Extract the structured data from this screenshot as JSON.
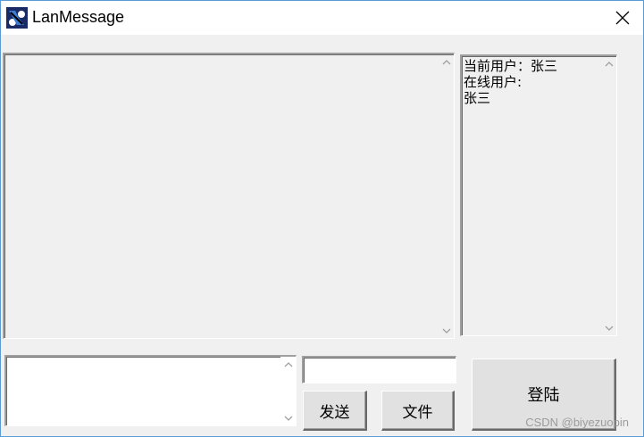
{
  "window": {
    "title": "LanMessage"
  },
  "user_panel": {
    "lines": [
      "当前用户：张三",
      "在线用户:",
      "张三"
    ]
  },
  "input": {
    "message_value": "",
    "target_value": ""
  },
  "buttons": {
    "send_label": "发送",
    "file_label": "文件",
    "login_label": "登陆"
  },
  "watermark": "CSDN @biyezuopin"
}
